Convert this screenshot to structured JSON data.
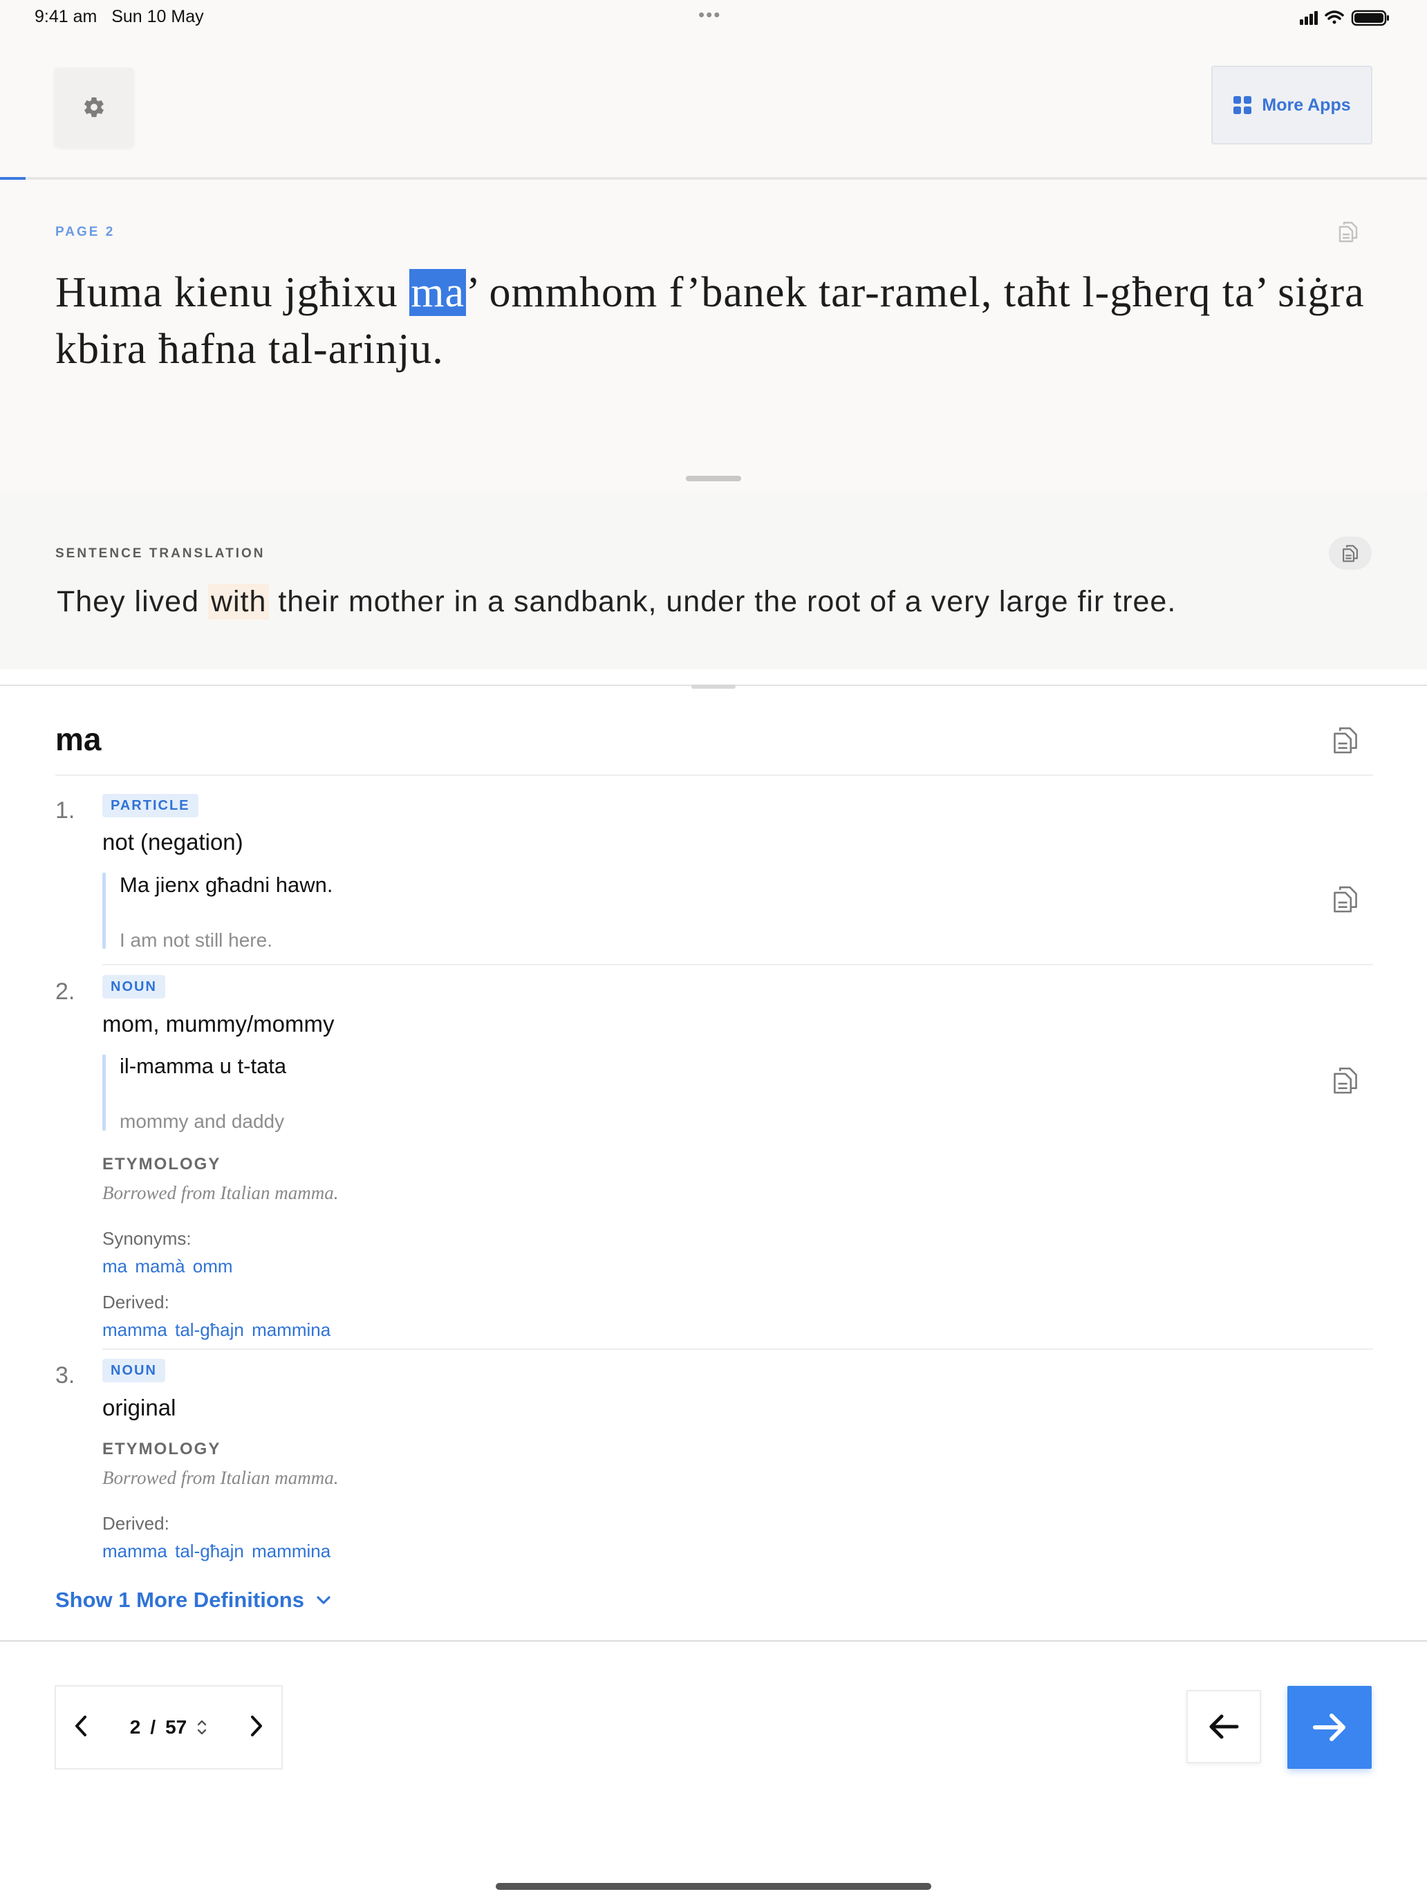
{
  "status": {
    "time": "9:41 am",
    "date": "Sun 10 May",
    "dots": "•••"
  },
  "header": {
    "settings_icon": "gear-icon",
    "more_apps_label": "More Apps",
    "more_apps_icon": "grid-icon",
    "reading_progress": 0.018
  },
  "reading": {
    "page_label": "PAGE  2",
    "text_before": "Huma kienu jgħixu ",
    "highlighted_word": "ma",
    "text_after": "’ ommhom f’banek tar-ramel, taħt l-għerq ta’ siġra kbira ħafna tal-arinju."
  },
  "translation": {
    "label": "SENTENCE TRANSLATION",
    "text_before": "They lived ",
    "highlighted_word": "with",
    "text_after": " their mother in a sandbank, under the root of a very large fir tree."
  },
  "dictionary": {
    "word": "ma",
    "definitions": [
      {
        "number": "1.",
        "pos": "PARTICLE",
        "gloss": "not (negation)",
        "example": "Ma jienx għadni hawn.",
        "example_translation": "I am not still here."
      },
      {
        "number": "2.",
        "pos": "NOUN",
        "gloss": "mom, mummy/mommy",
        "example": "il-mamma u t-tata",
        "example_translation": "mommy and daddy",
        "etymology_label": "ETYMOLOGY",
        "etymology": "Borrowed from Italian mamma.",
        "synonyms_label": "Synonyms:",
        "synonyms": "ma mamà omm",
        "derived_label": "Derived:",
        "derived": "mamma tal-għajn mammina"
      },
      {
        "number": "3.",
        "pos": "NOUN",
        "gloss": "original",
        "etymology_label": "ETYMOLOGY",
        "etymology": "Borrowed from Italian mamma.",
        "derived_label": "Derived:",
        "derived": "mamma tal-għajn mammina"
      }
    ],
    "show_more_label": "Show 1 More Definitions"
  },
  "pager": {
    "current": "2",
    "separator": "/",
    "total": "57"
  },
  "colors": {
    "accent": "#3a85f0",
    "link": "#2f73d6",
    "highlight_reading": "#3a7be2",
    "highlight_translation": "#fbeee2",
    "badge_bg": "#e4eefb"
  }
}
